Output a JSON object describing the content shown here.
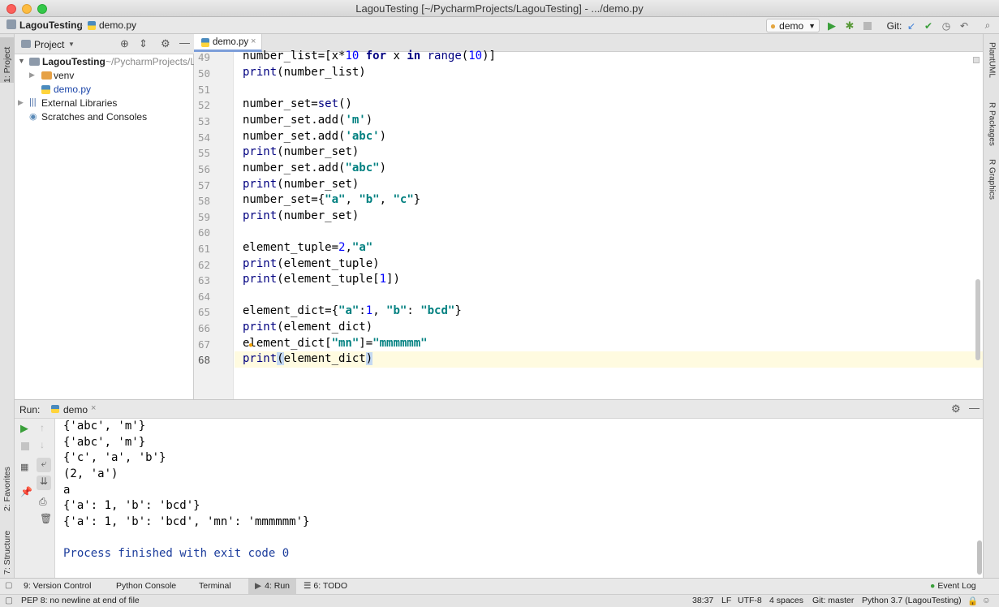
{
  "window": {
    "title": "LagouTesting [~/PycharmProjects/LagouTesting] - .../demo.py"
  },
  "nav": {
    "crumb_project": "LagouTesting",
    "crumb_file": "demo.py",
    "run_config": "demo",
    "git_label": "Git:"
  },
  "left_strip": {
    "project_tab": "1: Project",
    "favorites_tab": "2: Favorites",
    "structure_tab": "7: Structure"
  },
  "right_strip": {
    "tabs": [
      "PlantUML",
      "R Packages",
      "R Graphics"
    ]
  },
  "project_panel": {
    "title": "Project",
    "tree": [
      {
        "label": "LagouTesting",
        "suffix": " ~/PycharmProjects/L",
        "kind": "folder"
      },
      {
        "label": "venv",
        "kind": "folder-orange"
      },
      {
        "label": "demo.py",
        "kind": "py"
      },
      {
        "label": "External Libraries",
        "kind": "lib"
      },
      {
        "label": "Scratches and Consoles",
        "kind": "scratch"
      }
    ]
  },
  "editor": {
    "tab_label": "demo.py",
    "line_numbers": [
      "49",
      "50",
      "51",
      "52",
      "53",
      "54",
      "55",
      "56",
      "57",
      "58",
      "59",
      "60",
      "61",
      "62",
      "63",
      "64",
      "65",
      "66",
      "67",
      "68"
    ]
  },
  "run_panel": {
    "label": "Run:",
    "config": "demo",
    "output": [
      "{'abc', 'm'}",
      "{'abc', 'm'}",
      "{'c', 'a', 'b'}",
      "(2, 'a')",
      "a",
      "{'a': 1, 'b': 'bcd'}",
      "{'a': 1, 'b': 'bcd', 'mn': 'mmmmmm'}",
      "",
      "Process finished with exit code 0"
    ]
  },
  "bottom_tabs": {
    "version_control": "9: Version Control",
    "python_console": "Python Console",
    "terminal": "Terminal",
    "run": "4: Run",
    "todo": "6: TODO",
    "event_log": "Event Log"
  },
  "status": {
    "message": "PEP 8: no newline at end of file",
    "position": "38:37",
    "line_sep": "LF",
    "encoding": "UTF-8",
    "indent": "4 spaces",
    "git": "Git: master",
    "interpreter": "Python 3.7 (LagouTesting)"
  },
  "colors": {
    "keyword": "#000080",
    "string": "#008080",
    "number": "#0000ff",
    "caret_line": "#fffbe0",
    "selection_tab": "#ffffff",
    "console_blue": "#1c3d9c"
  }
}
